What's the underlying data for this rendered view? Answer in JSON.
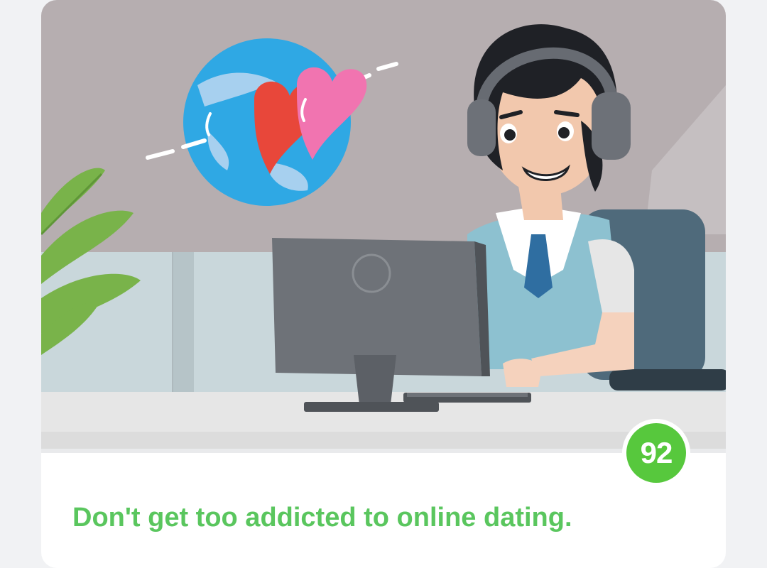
{
  "card": {
    "score": "92",
    "headline": "Don't get too addicted to online dating.",
    "score_color": "#57c83d",
    "headline_color": "#5ac65e"
  },
  "illustration": {
    "scene": "man-with-headset-at-computer-icon",
    "globe": "globe-with-hearts-icon"
  }
}
